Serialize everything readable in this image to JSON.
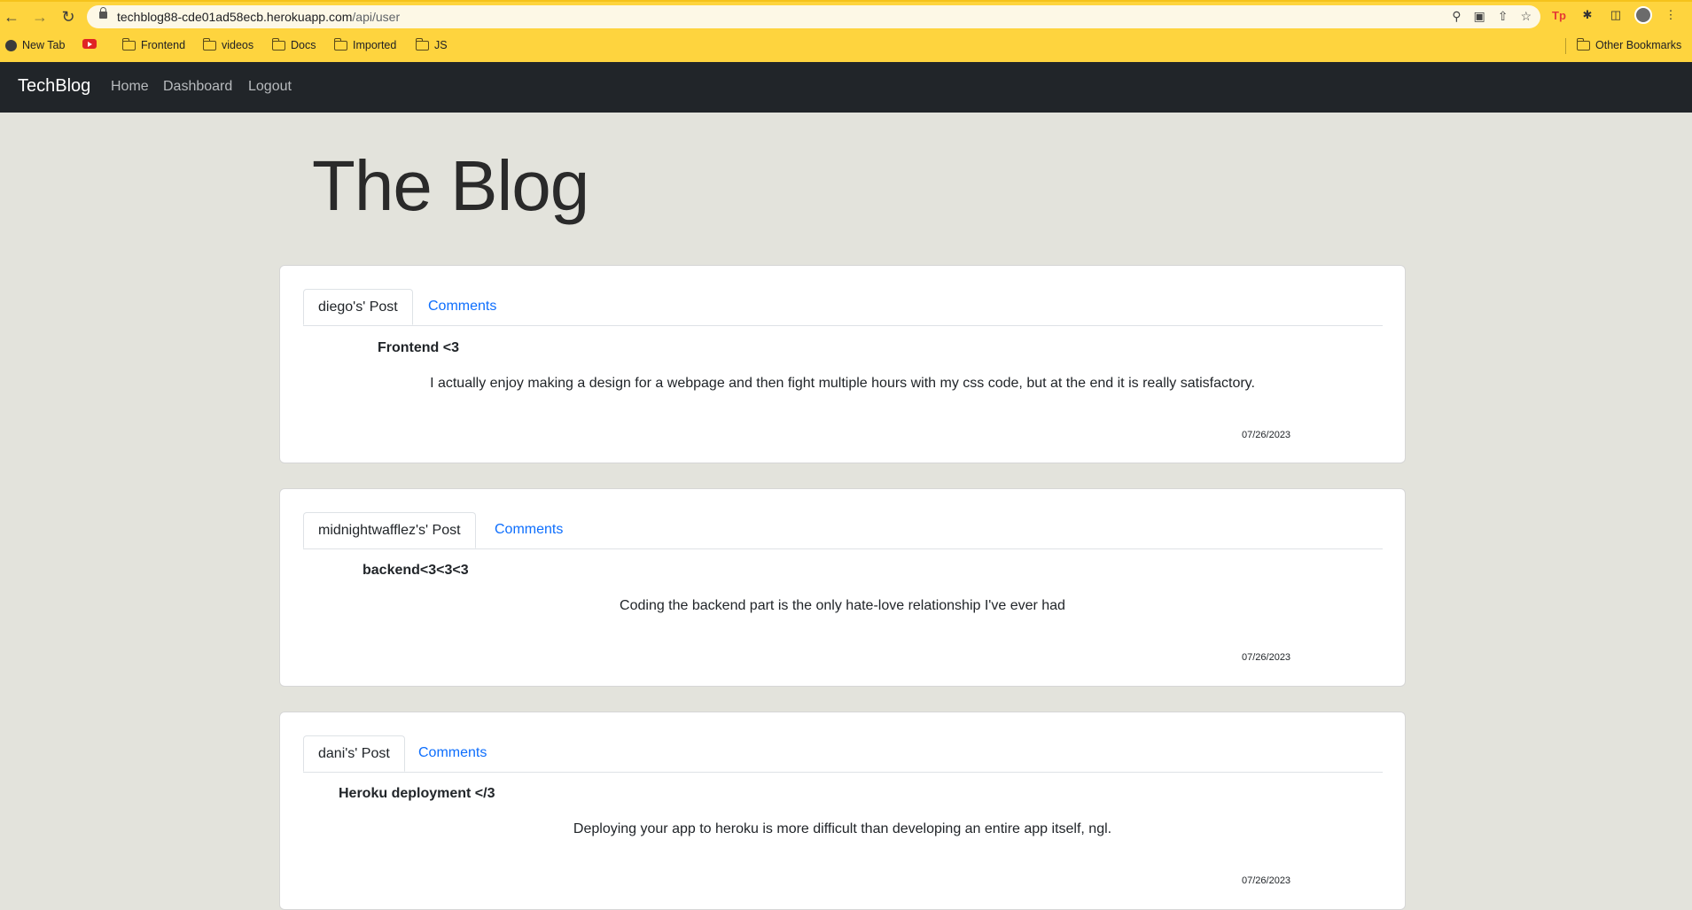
{
  "browser": {
    "url_host": "techblog88-cde01ad58ecb.herokuapp.com",
    "url_path": "/api/user",
    "bookmarks": [
      "New Tab",
      "Frontend",
      "videos",
      "Docs",
      "Imported",
      "JS"
    ],
    "other_bookmarks": "Other Bookmarks"
  },
  "navbar": {
    "brand": "TechBlog",
    "links": [
      "Home",
      "Dashboard",
      "Logout"
    ]
  },
  "main": {
    "title": "The Blog",
    "posts": [
      {
        "tab_label": "diego's' Post",
        "comments_label": "Comments",
        "title": "Frontend <3",
        "body": "I actually enjoy making a design for a webpage and then fight multiple hours with my css code, but at the end it is really satisfactory.",
        "date": "07/26/2023"
      },
      {
        "tab_label": "midnightwafflez's' Post",
        "comments_label": "Comments",
        "title": "backend<3<3<3",
        "body": "Coding the backend part is the only hate-love relationship I've ever had",
        "date": "07/26/2023"
      },
      {
        "tab_label": "dani's' Post",
        "comments_label": "Comments",
        "title": "Heroku deployment </3",
        "body": "Deploying your app to heroku is more difficult than developing an entire app itself, ngl.",
        "date": "07/26/2023"
      }
    ]
  },
  "colors": {
    "chrome_bar": "#fed43e",
    "navbar_bg": "#212529",
    "page_bg": "#e3e3dc",
    "link_blue": "#0d6efd"
  }
}
